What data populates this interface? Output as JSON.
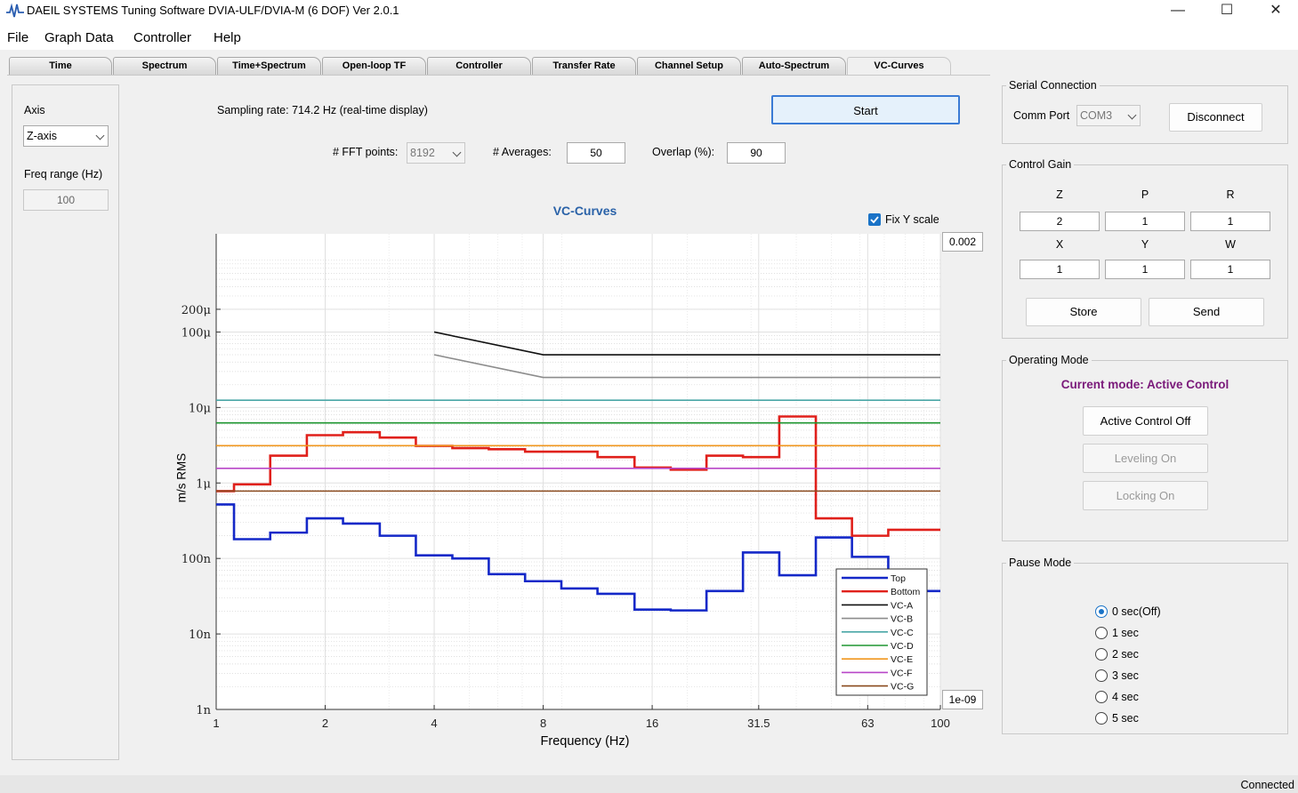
{
  "window": {
    "title": "DAEIL SYSTEMS Tuning Software DVIA-ULF/DVIA-M (6 DOF) Ver 2.0.1",
    "controls": {
      "minimize": "—",
      "maximize": "☐",
      "close": "✕"
    }
  },
  "menu": [
    "File",
    "Graph Data",
    "Controller",
    "Help"
  ],
  "tabs": [
    "Time",
    "Spectrum",
    "Time+Spectrum",
    "Open-loop TF",
    "Controller",
    "Transfer Rate",
    "Channel Setup",
    "Auto-Spectrum",
    "VC-Curves"
  ],
  "active_tab": "VC-Curves",
  "left_panel": {
    "axis_label": "Axis",
    "axis_value": "Z-axis",
    "freq_label": "Freq range (Hz)",
    "freq_value": "100"
  },
  "top_controls": {
    "sampling_text": "Sampling rate: 714.2 Hz (real-time display)",
    "start_label": "Start",
    "fft_label": "# FFT points:",
    "fft_value": "8192",
    "avg_label": "# Averages:",
    "avg_value": "50",
    "overlap_label": "Overlap (%):",
    "overlap_value": "90"
  },
  "plot": {
    "fix_y_label": "Fix Y scale",
    "y_max_value": "0.002",
    "y_min_value": "1e-09"
  },
  "chart_data": {
    "type": "line",
    "title": "VC-Curves",
    "xlabel": "Frequency (Hz)",
    "ylabel": "m/s RMS",
    "x_scale": "log",
    "y_scale": "log",
    "xlim": [
      1,
      100
    ],
    "ylim": [
      1e-09,
      0.002
    ],
    "x_ticks": [
      1,
      2,
      4,
      8,
      16,
      31.5,
      63,
      100
    ],
    "x_tick_labels": [
      "1",
      "2",
      "4",
      "8",
      "16",
      "31.5",
      "63",
      "100"
    ],
    "y_ticks": [
      1e-09,
      1e-08,
      1e-07,
      1e-06,
      1e-05,
      0.0001,
      0.0002
    ],
    "y_tick_labels": [
      "1n",
      "10n",
      "100n",
      "1μ",
      "10μ",
      "100μ",
      "200μ"
    ],
    "grid": true,
    "legend_position": "bottom-right",
    "series": [
      {
        "name": "Top",
        "color": "#1428c8",
        "step": true,
        "x": [
          1,
          1.12,
          1.41,
          1.78,
          2.24,
          2.83,
          3.56,
          4.49,
          5.66,
          7.13,
          8.98,
          11.3,
          14.3,
          18,
          22.6,
          28.5,
          35.9,
          45.3,
          57,
          71.8,
          90.5,
          100
        ],
        "y": [
          5.2e-07,
          1.8e-07,
          2.2e-07,
          3.4e-07,
          2.9e-07,
          2e-07,
          1.1e-07,
          1e-07,
          6.2e-08,
          5e-08,
          4e-08,
          3.4e-08,
          2.1e-08,
          2.05e-08,
          3.7e-08,
          1.2e-07,
          6e-08,
          1.9e-07,
          1.05e-07,
          6.5e-08,
          3.7e-08,
          3.7e-08
        ]
      },
      {
        "name": "Bottom",
        "color": "#e0201b",
        "step": true,
        "x": [
          1,
          1.12,
          1.41,
          1.78,
          2.24,
          2.83,
          3.56,
          4.49,
          5.66,
          7.13,
          8.98,
          11.3,
          14.3,
          18,
          22.6,
          28.5,
          35.9,
          45.3,
          57,
          71.8,
          90.5,
          100
        ],
        "y": [
          7.8e-07,
          9.6e-07,
          2.3e-06,
          4.3e-06,
          4.7e-06,
          4e-06,
          3.1e-06,
          2.9e-06,
          2.8e-06,
          2.6e-06,
          2.6e-06,
          2.2e-06,
          1.6e-06,
          1.5e-06,
          2.3e-06,
          2.2e-06,
          7.6e-06,
          3.4e-07,
          2e-07,
          2.4e-07,
          2.4e-07,
          2.4e-07
        ]
      },
      {
        "name": "VC-A",
        "color": "#111111",
        "x": [
          4,
          8,
          100
        ],
        "y": [
          0.0001,
          5e-05,
          5e-05
        ]
      },
      {
        "name": "VC-B",
        "color": "#8c8c8c",
        "x": [
          4,
          8,
          100
        ],
        "y": [
          5e-05,
          2.5e-05,
          2.5e-05
        ]
      },
      {
        "name": "VC-C",
        "color": "#4aa6a6",
        "x": [
          1,
          100
        ],
        "y": [
          1.25e-05,
          1.25e-05
        ]
      },
      {
        "name": "VC-D",
        "color": "#1e9630",
        "x": [
          1,
          100
        ],
        "y": [
          6.25e-06,
          6.25e-06
        ]
      },
      {
        "name": "VC-E",
        "color": "#f0961e",
        "x": [
          1,
          100
        ],
        "y": [
          3.125e-06,
          3.125e-06
        ]
      },
      {
        "name": "VC-F",
        "color": "#b846c8",
        "x": [
          1,
          100
        ],
        "y": [
          1.5625e-06,
          1.5625e-06
        ]
      },
      {
        "name": "VC-G",
        "color": "#8a4a1e",
        "x": [
          1,
          100
        ],
        "y": [
          7.8125e-07,
          7.8125e-07
        ]
      }
    ]
  },
  "serial": {
    "title": "Serial Connection",
    "port_label": "Comm Port",
    "port_value": "COM3",
    "disconnect_label": "Disconnect"
  },
  "gain": {
    "title": "Control Gain",
    "headers_top": [
      "Z",
      "P",
      "R"
    ],
    "values_top": [
      "2",
      "1",
      "1"
    ],
    "headers_bottom": [
      "X",
      "Y",
      "W"
    ],
    "values_bottom": [
      "1",
      "1",
      "1"
    ],
    "store_label": "Store",
    "send_label": "Send"
  },
  "operating": {
    "title": "Operating Mode",
    "current_mode": "Current mode: Active Control",
    "mode_color": "#7a1a7a",
    "active_off_label": "Active Control Off",
    "leveling_label": "Leveling On",
    "locking_label": "Locking On"
  },
  "pause": {
    "title": "Pause Mode",
    "options": [
      "0 sec(Off)",
      "1 sec",
      "2 sec",
      "3 sec",
      "4 sec",
      "5 sec"
    ],
    "selected_index": 0
  },
  "status": {
    "text": "Connected"
  }
}
